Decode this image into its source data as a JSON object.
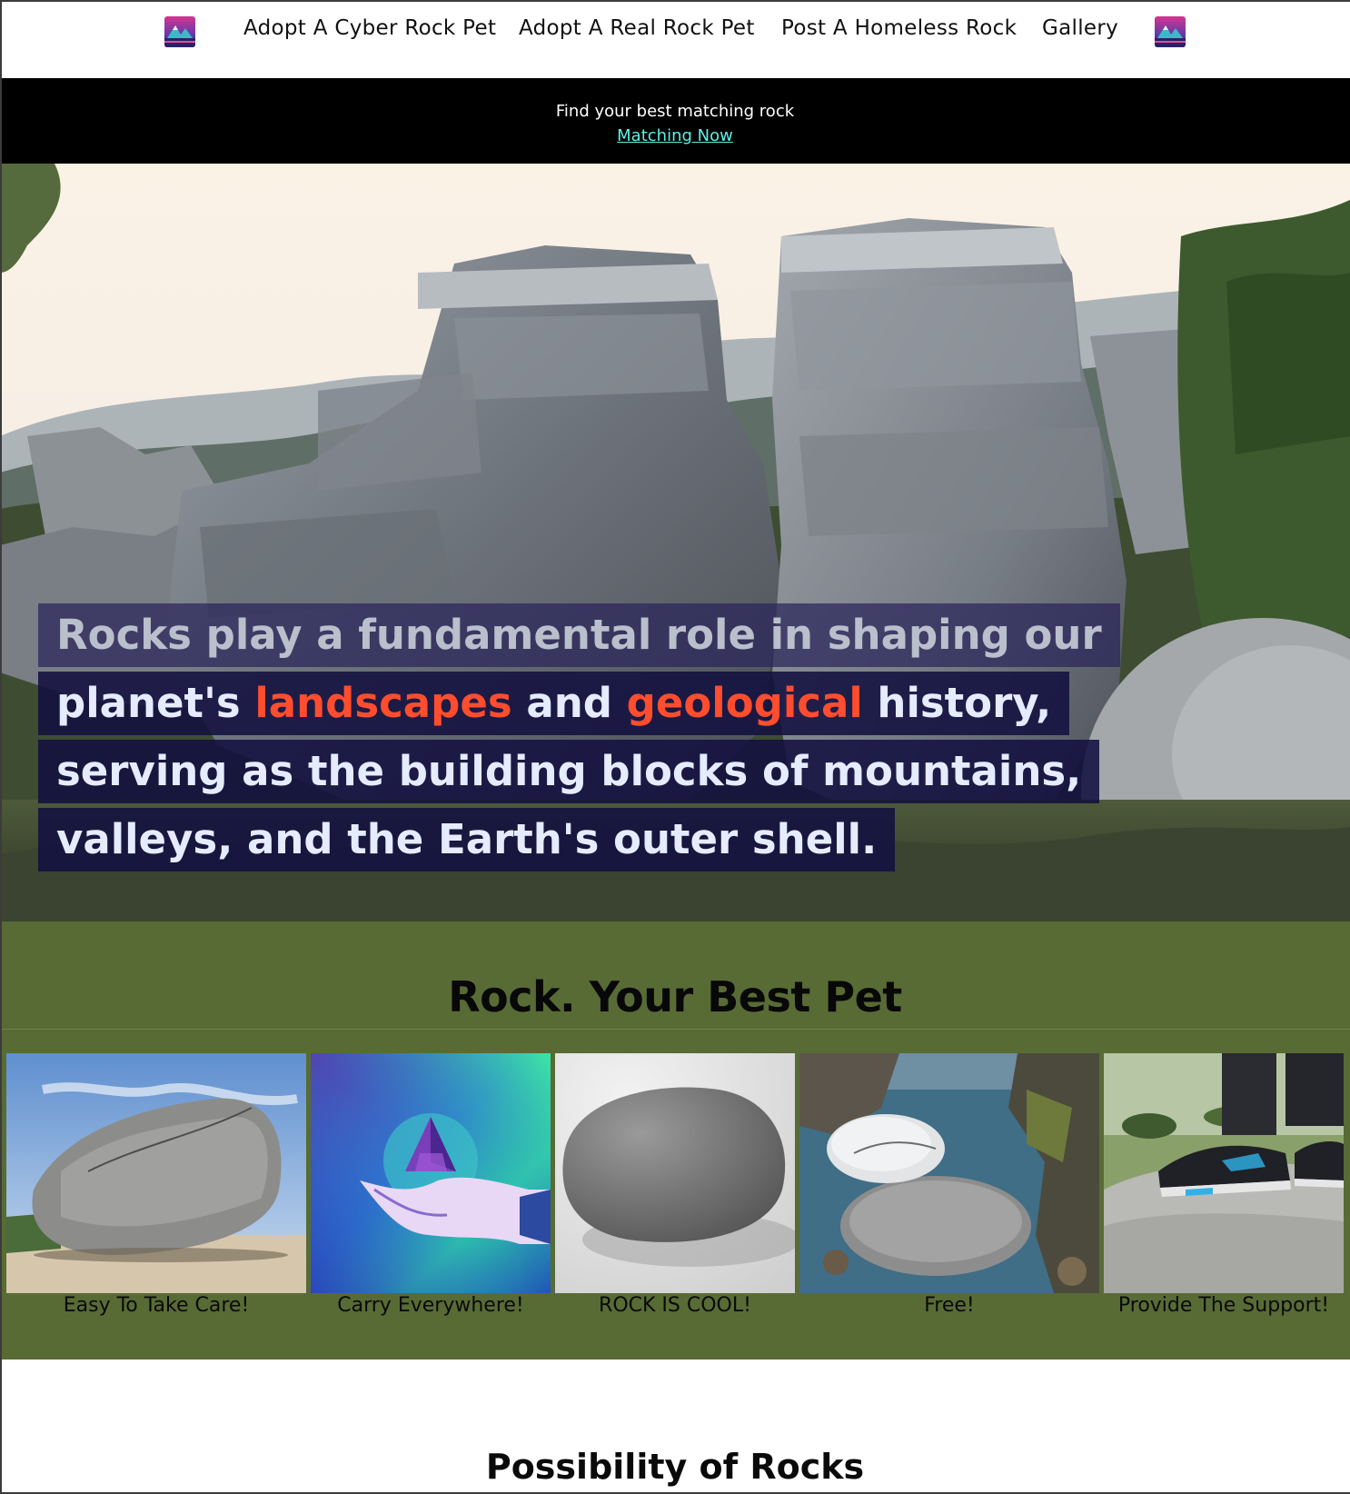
{
  "nav": {
    "links": [
      "Adopt A Cyber Rock Pet",
      "Adopt A Real Rock Pet",
      "Post A Homeless Rock",
      "Gallery"
    ],
    "logo_icon": "mountain-sunset-logo-icon"
  },
  "banner": {
    "text": "Find your best matching rock",
    "link": "Matching Now",
    "link_color": "#5ff0e6"
  },
  "hero": {
    "caption": {
      "line1": "Rocks play a fundamental role in shaping our",
      "line2_a": "planet's ",
      "line2_hl1": "landscapes",
      "line2_b": " and ",
      "line2_hl2": "geological",
      "line2_c": " history,",
      "line3": "serving as the building blocks of mountains,",
      "line4": "valleys, and the Earth's outer shell."
    },
    "highlight_color": "#ff4d2e"
  },
  "pets": {
    "title": "Rock. Your Best Pet",
    "background": "#586b35",
    "cards": [
      {
        "label": "Easy To Take Care!"
      },
      {
        "label": "Carry Everywhere!"
      },
      {
        "label": "ROCK IS COOL!"
      },
      {
        "label": "Free!"
      },
      {
        "label": "Provide The Support!"
      }
    ]
  },
  "possibility": {
    "title": "Possibility of Rocks"
  }
}
